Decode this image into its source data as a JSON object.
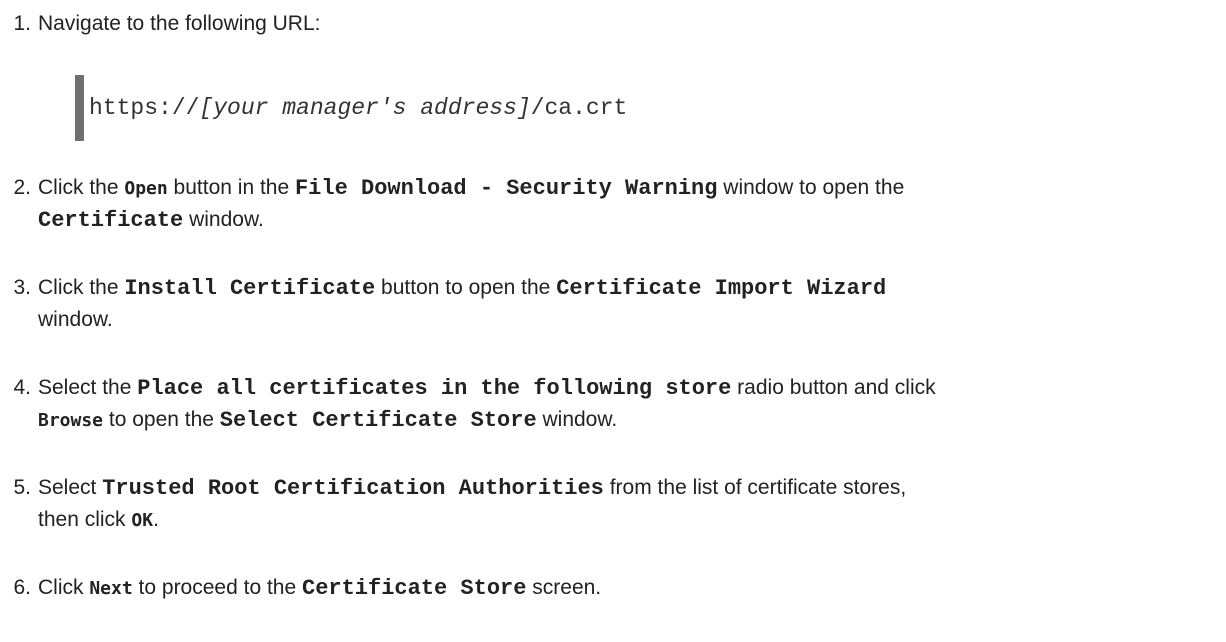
{
  "steps": [
    {
      "num": "1.",
      "line1": {
        "t1": "Navigate to the following URL:"
      }
    },
    {
      "num": "2.",
      "line1": {
        "t1": "Click the ",
        "b1": "Open",
        "t2": " button in the ",
        "g1": "File Download - Security Warning",
        "t3": " window to open the"
      },
      "line2": {
        "g1": "Certificate",
        "t1": " window."
      }
    },
    {
      "num": "3.",
      "line1": {
        "t1": "Click the ",
        "g1": "Install Certificate",
        "t2": " button to open the ",
        "g2": "Certificate Import Wizard"
      },
      "line2": {
        "t1": "window."
      }
    },
    {
      "num": "4.",
      "line1": {
        "t1": "Select the ",
        "g1": "Place all certificates in the following store",
        "t2": " radio button and click"
      },
      "line2": {
        "b1": "Browse",
        "t1": " to open the ",
        "g1": "Select Certificate Store",
        "t2": " window."
      }
    },
    {
      "num": "5.",
      "line1": {
        "t1": "Select ",
        "g1": "Trusted Root Certification Authorities",
        "t2": " from the list of certificate stores,"
      },
      "line2": {
        "t1": "then click ",
        "b1": "OK",
        "t2": "."
      }
    },
    {
      "num": "6.",
      "line1": {
        "t1": "Click ",
        "b1": "Next",
        "t2": " to proceed to the ",
        "g1": "Certificate Store",
        "t3": " screen."
      }
    }
  ],
  "code": {
    "prefix": "https://",
    "replaceable": "[your manager's address]",
    "suffix": "/ca.crt"
  }
}
